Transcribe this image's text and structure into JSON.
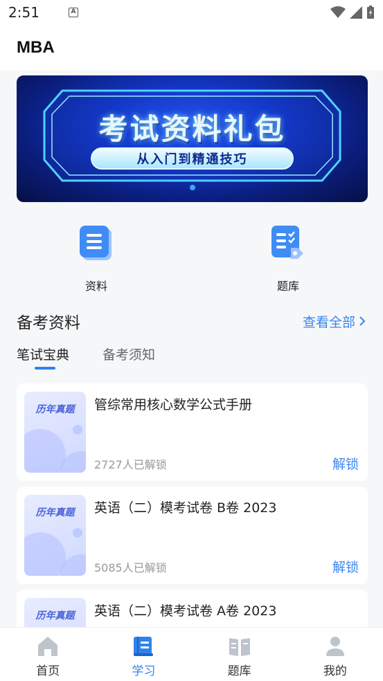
{
  "status": {
    "time": "2:51"
  },
  "header": {
    "title": "MBA"
  },
  "banner": {
    "title": "考试资料礼包",
    "subtitle": "从入门到精通技巧"
  },
  "quick": [
    {
      "label": "资料",
      "icon": "document-list-icon"
    },
    {
      "label": "题库",
      "icon": "checklist-icon"
    }
  ],
  "section": {
    "title": "备考资料",
    "more": "查看全部"
  },
  "tabs": [
    {
      "label": "笔试宝典"
    },
    {
      "label": "备考须知"
    }
  ],
  "cards": [
    {
      "thumb": "历年真题",
      "title": "管综常用核心数学公式手册",
      "count": "2727人已解锁",
      "action": "解锁"
    },
    {
      "thumb": "历年真题",
      "title": "英语（二）模考试卷 B卷 2023",
      "count": "5085人已解锁",
      "action": "解锁"
    },
    {
      "thumb": "历年真题",
      "title": "英语（二）模考试卷 A卷 2023",
      "count": "",
      "action": ""
    }
  ],
  "nav": [
    {
      "label": "首页",
      "icon": "home-icon"
    },
    {
      "label": "学习",
      "icon": "book-icon"
    },
    {
      "label": "题库",
      "icon": "open-book-icon"
    },
    {
      "label": "我的",
      "icon": "user-icon"
    }
  ],
  "colors": {
    "accent": "#2e82f0",
    "link": "#3a86f2",
    "background": "#f6f7f9"
  }
}
